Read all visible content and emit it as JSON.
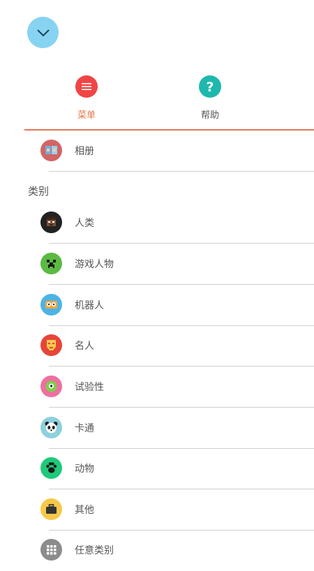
{
  "tabs": [
    {
      "label": "菜单",
      "icon": "menu-icon",
      "color": "#f04545"
    },
    {
      "label": "帮助",
      "icon": "help-icon",
      "color": "#1fb8ad"
    }
  ],
  "album": {
    "label": "相册",
    "icon": "album-icon"
  },
  "section_title": "类别",
  "categories": [
    {
      "label": "人类",
      "icon": "human-icon",
      "color": "#222222"
    },
    {
      "label": "游戏人物",
      "icon": "game-character-icon",
      "color": "#5bba43"
    },
    {
      "label": "机器人",
      "icon": "robot-icon",
      "color": "#4db3e6"
    },
    {
      "label": "名人",
      "icon": "celebrity-icon",
      "color": "#e8443a"
    },
    {
      "label": "试验性",
      "icon": "experimental-icon",
      "color": "#ee6fa0"
    },
    {
      "label": "卡通",
      "icon": "cartoon-icon",
      "color": "#8ed0dd"
    },
    {
      "label": "动物",
      "icon": "animal-icon",
      "color": "#1fc979"
    },
    {
      "label": "其他",
      "icon": "other-icon",
      "color": "#f5c84a"
    },
    {
      "label": "任意类别",
      "icon": "any-category-icon",
      "color": "#8c8c8c"
    }
  ]
}
